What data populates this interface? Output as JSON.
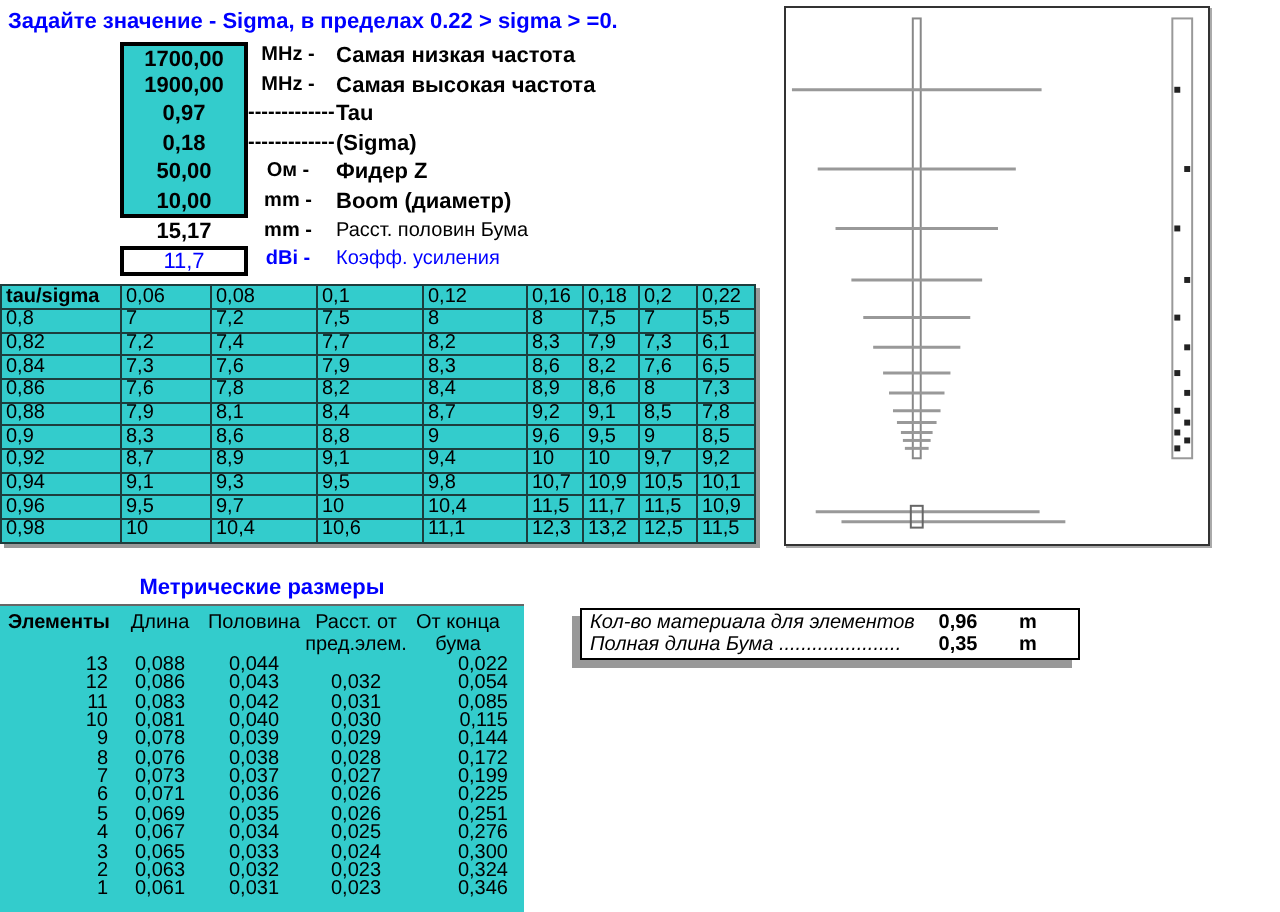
{
  "heading": "Задайте значение - Sigma, в пределах  0.22 > sigma > =0.",
  "parameters": [
    {
      "kind": "input",
      "value": "1700,00",
      "unit": "MHz  -",
      "label": "Самая низкая частота"
    },
    {
      "kind": "input",
      "value": "1900,00",
      "unit": "MHz  -",
      "label": "Самая высокая частота"
    },
    {
      "kind": "input",
      "value": "0,97",
      "unit": "-------------",
      "label": "Tau"
    },
    {
      "kind": "input",
      "value": "0,18",
      "unit": "-------------",
      "label": "(Sigma)"
    },
    {
      "kind": "input",
      "value": "50,00",
      "unit": "Ом -",
      "label": "Фидер Z"
    },
    {
      "kind": "input",
      "value": "10,00",
      "unit": "mm  -",
      "label": "Boom (диаметр)"
    },
    {
      "kind": "computed",
      "value": "15,17",
      "unit": "mm  -",
      "label": "Расст. половин Бума"
    },
    {
      "kind": "result",
      "value": "11,7",
      "unit": "dBi  -",
      "label": "Коэфф. усиления"
    }
  ],
  "gain_table": {
    "columns": [
      "tau/sigma",
      "0,06",
      "0,08",
      "0,1",
      "0,12",
      "0,16",
      "0,18",
      "0,2",
      "0,22"
    ],
    "rows": [
      [
        "0,8",
        "7",
        "7,2",
        "7,5",
        "8",
        "8",
        "7,5",
        "7",
        "5,5"
      ],
      [
        "0,82",
        "7,2",
        "7,4",
        "7,7",
        "8,2",
        "8,3",
        "7,9",
        "7,3",
        "6,1"
      ],
      [
        "0,84",
        "7,3",
        "7,6",
        "7,9",
        "8,3",
        "8,6",
        "8,2",
        "7,6",
        "6,5"
      ],
      [
        "0,86",
        "7,6",
        "7,8",
        "8,2",
        "8,4",
        "8,9",
        "8,6",
        "8",
        "7,3"
      ],
      [
        "0,88",
        "7,9",
        "8,1",
        "8,4",
        "8,7",
        "9,2",
        "9,1",
        "8,5",
        "7,8"
      ],
      [
        "0,9",
        "8,3",
        "8,6",
        "8,8",
        "9",
        "9,6",
        "9,5",
        "9",
        "8,5"
      ],
      [
        "0,92",
        "8,7",
        "8,9",
        "9,1",
        "9,4",
        "10",
        "10",
        "9,7",
        "9,2"
      ],
      [
        "0,94",
        "9,1",
        "9,3",
        "9,5",
        "9,8",
        "10,7",
        "10,9",
        "10,5",
        "10,1"
      ],
      [
        "0,96",
        "9,5",
        "9,7",
        "10",
        "10,4",
        "11,5",
        "11,7",
        "11,5",
        "10,9"
      ],
      [
        "0,98",
        "10",
        "10,4",
        "10,6",
        "11,1",
        "12,3",
        "13,2",
        "12,5",
        "11,5"
      ]
    ]
  },
  "metric": {
    "title": "Метрические размеры",
    "columns": [
      "Элементы",
      "Длина",
      "Половина",
      "Расст. от пред.элем.",
      "От конца бума"
    ],
    "rows": [
      [
        "13",
        "0,088",
        "0,044",
        "",
        "0,022"
      ],
      [
        "12",
        "0,086",
        "0,043",
        "0,032",
        "0,054"
      ],
      [
        "11",
        "0,083",
        "0,042",
        "0,031",
        "0,085"
      ],
      [
        "10",
        "0,081",
        "0,040",
        "0,030",
        "0,115"
      ],
      [
        "9",
        "0,078",
        "0,039",
        "0,029",
        "0,144"
      ],
      [
        "8",
        "0,076",
        "0,038",
        "0,028",
        "0,172"
      ],
      [
        "7",
        "0,073",
        "0,037",
        "0,027",
        "0,199"
      ],
      [
        "6",
        "0,071",
        "0,036",
        "0,026",
        "0,225"
      ],
      [
        "5",
        "0,069",
        "0,035",
        "0,026",
        "0,251"
      ],
      [
        "4",
        "0,067",
        "0,034",
        "0,025",
        "0,276"
      ],
      [
        "3",
        "0,065",
        "0,033",
        "0,024",
        "0,300"
      ],
      [
        "2",
        "0,063",
        "0,032",
        "0,023",
        "0,324"
      ],
      [
        "1",
        "0,061",
        "0,031",
        "0,023",
        "0,346"
      ]
    ]
  },
  "summary": [
    {
      "label": "Кол-во материала для элементов",
      "value": "0,96",
      "unit": "m"
    },
    {
      "label": "Полная длина Бума ......................",
      "value": "0,35",
      "unit": "m"
    }
  ]
}
